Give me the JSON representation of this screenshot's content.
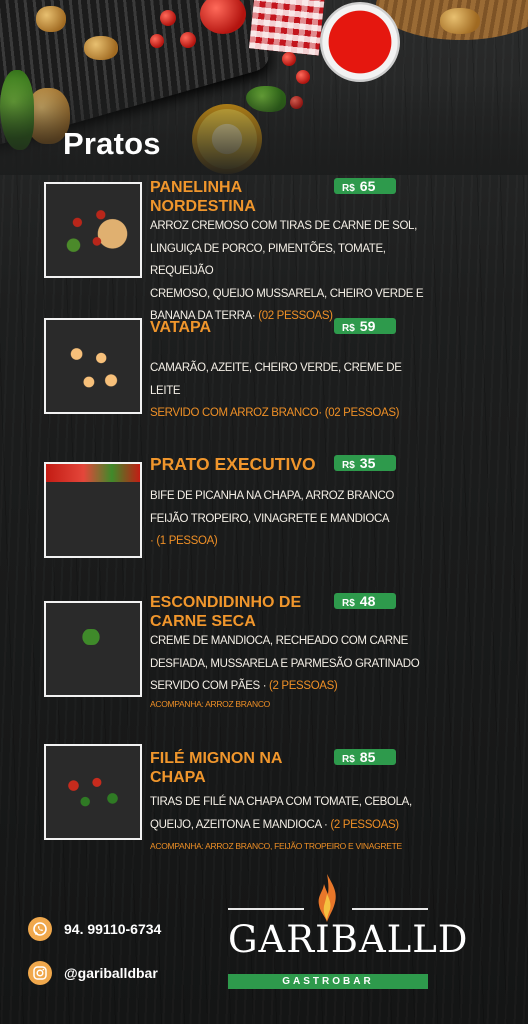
{
  "section_title": "Pratos",
  "currency": "R$",
  "dishes": [
    {
      "name_lines": [
        "PANELINHA",
        "NORDESTINA"
      ],
      "price": "65",
      "desc_lines": [
        "ARROZ CREMOSO COM TIRAS DE CARNE DE SOL,",
        "LINGUIÇA DE PORCO, PIMENTÕES, TOMATE, REQUEIJÃO",
        "CREMOSO, QUEIJO MUSSARELA, CHEIRO VERDE E",
        "BANANA DA TERRA·"
      ],
      "serving": "(02 PESSOAS)"
    },
    {
      "name_lines": [
        "VATAPA"
      ],
      "price": "59",
      "desc_lines": [
        "CAMARÃO, AZEITE, CHEIRO VERDE, CREME DE LEITE"
      ],
      "serving": "SERVIDO COM ARROZ BRANCO· (02 PESSOAS)"
    },
    {
      "name_lines": [
        "PRATO EXECUTIVO"
      ],
      "price": "35",
      "desc_lines": [
        "BIFE DE PICANHA NA CHAPA, ARROZ BRANCO",
        "FEIJÃO TROPEIRO, VINAGRETE E MANDIOCA"
      ],
      "serving": "· (1 PESSOA)"
    },
    {
      "name_lines": [
        "ESCONDIDINHO DE",
        "CARNE SECA"
      ],
      "price": "48",
      "desc_lines": [
        "CREME DE MANDIOCA, RECHEADO COM CARNE",
        "DESFIADA, MUSSARELA E PARMESÃO GRATINADO",
        "SERVIDO COM  PÃES ·"
      ],
      "serving": "(2 PESSOAS)",
      "extra": "ACOMPANHA: ARROZ BRANCO"
    },
    {
      "name_lines": [
        "FILÉ MIGNON NA",
        "CHAPA"
      ],
      "price": "85",
      "desc_lines": [
        "TIRAS DE FILÉ NA CHAPA COM TOMATE, CEBOLA,",
        "QUEIJO, AZEITONA E MANDIOCA ·"
      ],
      "serving": "(2 PESSOAS)",
      "extra": "ACOMPANHA: ARROZ BRANCO, FEIJÃO TROPEIRO E VINAGRETE"
    }
  ],
  "contacts": {
    "phone": "94. 99110-6734",
    "instagram": "@gariballdbar",
    "phone_icon": "whatsapp-icon",
    "instagram_icon": "instagram-icon"
  },
  "logo": {
    "name": "GARIBALLD",
    "subtitle": "GASTROBAR",
    "icon": "flame-icon"
  },
  "colors": {
    "accent_orange": "#f0962c",
    "price_green": "#2e9a4c",
    "background": "#1d1e1e",
    "contact_icon": "#f0a84c"
  }
}
